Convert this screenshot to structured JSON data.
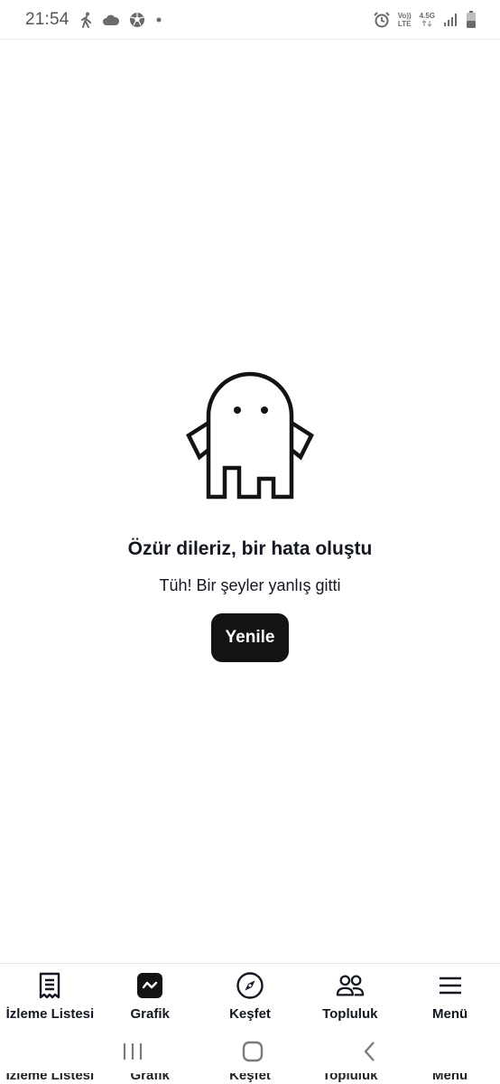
{
  "status_bar": {
    "time": "21:54",
    "left_icons": [
      "walking-icon",
      "cloud-icon",
      "soccer-ball-icon",
      "dot-icon"
    ],
    "right_icons": [
      "alarm-icon",
      "volte-icon",
      "network-4-5g-icon",
      "signal-icon",
      "battery-icon"
    ],
    "volte_top": "Vo))",
    "volte_bottom": "LTE",
    "network_label": "4.5G"
  },
  "error": {
    "illustration": "ghost-illustration",
    "title": "Özür dileriz, bir hata oluştu",
    "subtitle": "Tüh! Bir şeyler yanlış gitti",
    "reload_label": "Yenile"
  },
  "tab_bar": {
    "tabs": [
      {
        "label": "İzleme Listesi",
        "icon": "watchlist-icon"
      },
      {
        "label": "Grafik",
        "icon": "chart-icon"
      },
      {
        "label": "Keşfet",
        "icon": "compass-icon"
      },
      {
        "label": "Topluluk",
        "icon": "community-icon"
      },
      {
        "label": "Menü",
        "icon": "menu-icon"
      }
    ]
  },
  "system_nav": {
    "buttons": [
      "recent-apps-icon",
      "home-icon",
      "back-icon"
    ]
  }
}
